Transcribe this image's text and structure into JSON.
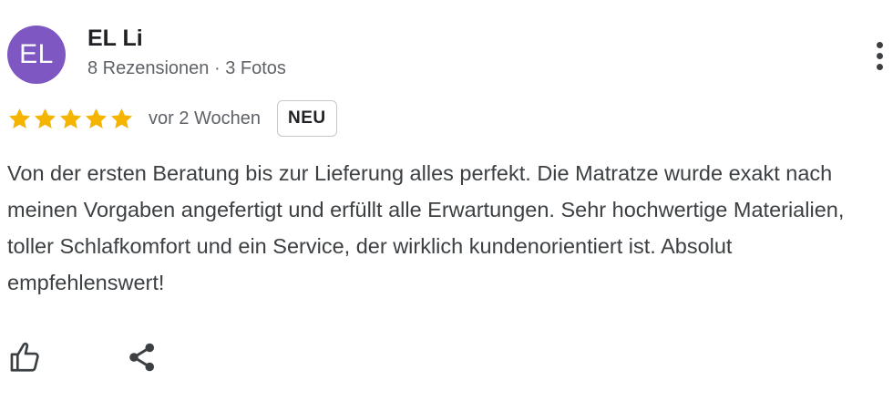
{
  "review": {
    "author": {
      "initials": "EL",
      "name": "EL Li",
      "meta": "8 Rezensionen · 3 Fotos",
      "avatar_color": "#7e57c2"
    },
    "rating": 5,
    "max_rating": 5,
    "star_color": "#f4b400",
    "time_ago": "vor 2 Wochen",
    "badge": "NEU",
    "text": "Von der ersten Beratung bis zur Lieferung alles perfekt. Die Matratze wurde exakt nach meinen Vorgaben angefertigt und erfüllt alle Erwartungen. Sehr hochwertige Materialien, toller Schlafkomfort und ein Service, der wirklich kundenorientiert ist. Absolut empfehlenswert!"
  },
  "icons": {
    "more": "more-vert-icon",
    "like": "thumb-up-icon",
    "share": "share-icon",
    "star": "star-icon"
  }
}
